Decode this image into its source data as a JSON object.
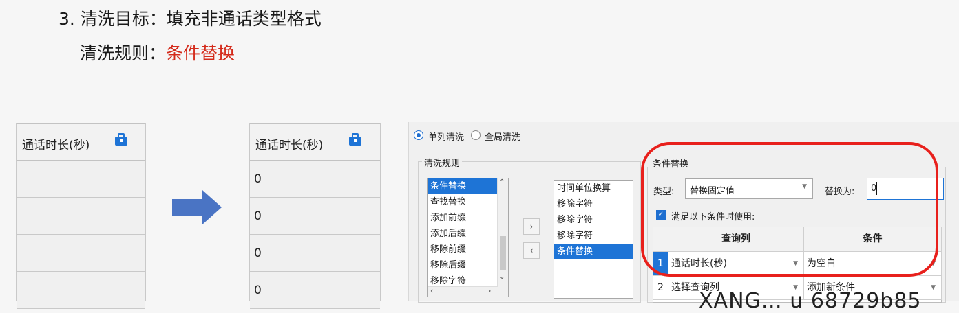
{
  "heading": {
    "line1": "3. 清洗目标：填充非通话类型格式",
    "line2_label": "清洗规则：",
    "line2_value": "条件替换"
  },
  "before_table": {
    "header": "通话时长(秒)",
    "rows": [
      "",
      "",
      "",
      ""
    ]
  },
  "after_table": {
    "header": "通话时长(秒)",
    "rows": [
      "0",
      "0",
      "0",
      "0"
    ]
  },
  "dialog": {
    "mode_single": "单列清洗",
    "mode_global": "全局清洗",
    "rules_group": "清洗规则",
    "available_rules": [
      "条件替换",
      "查找替换",
      "添加前缀",
      "添加后缀",
      "移除前缀",
      "移除后缀",
      "移除字符"
    ],
    "applied_rules": [
      "时间单位换算",
      "移除字符",
      "移除字符",
      "移除字符",
      "条件替换"
    ],
    "add_button": "›",
    "remove_button": "‹",
    "cond_group": "条件替换",
    "type_label": "类型:",
    "type_value": "替换固定值",
    "replace_label": "替换为:",
    "replace_value": "0",
    "checkbox_label": "满足以下条件时使用:",
    "grid_headers": [
      "查询列",
      "条件"
    ],
    "grid_rows": [
      {
        "num": "1",
        "col": "通话时长(秒)",
        "cond": "为空白"
      },
      {
        "num": "2",
        "col": "选择查询列",
        "cond": "添加新条件"
      }
    ]
  },
  "watermark": "XANG… u  68729b85",
  "colors": {
    "accent_red": "#d42a1a",
    "selection_blue": "#1e74d6",
    "ring_red": "#e8201c"
  }
}
